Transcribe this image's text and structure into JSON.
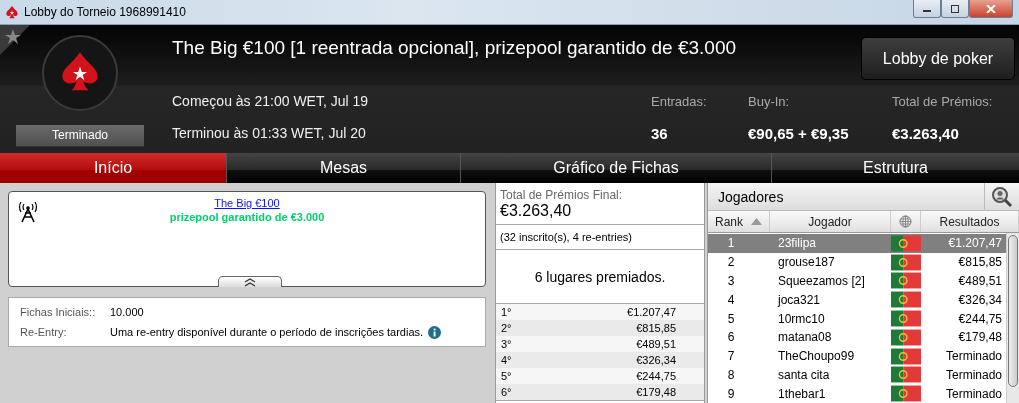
{
  "window": {
    "title": "Lobby do Torneio 1968991410"
  },
  "header": {
    "title": "The Big €100 [1 reentrada opcional], prizepool garantido de €3.000",
    "status": "Terminado",
    "started": "Começou às 21:00 WET, Jul 19",
    "ended": "Terminou às 01:33 WET, Jul 20",
    "button": "Lobby de poker",
    "stats": [
      {
        "label": "Entradas:",
        "value": "36"
      },
      {
        "label": "Buy-In:",
        "value": "€90,65 + €9,35"
      },
      {
        "label": "Total de Prémios:",
        "value": "€3.263,40"
      }
    ]
  },
  "tabs": [
    {
      "label": "Início",
      "selected": true
    },
    {
      "label": "Mesas",
      "selected": false
    },
    {
      "label": "Gráfico de Fichas",
      "selected": false
    },
    {
      "label": "Estrutura",
      "selected": false
    }
  ],
  "news": {
    "link": "The Big €100",
    "subtitle": "prizepool garantido de €3.000"
  },
  "info": [
    {
      "label": "Fichas Iniciais::",
      "value": "10.000",
      "has_info": false
    },
    {
      "label": "Re-Entry:",
      "value": "Uma re-entry disponível durante o período de inscrições tardias.",
      "has_info": true
    }
  ],
  "prizes": {
    "total_label": "Total de Prémios Final:",
    "total": "€3.263,40",
    "entries": "(32 inscrito(s), 4 re-entries)",
    "places": "6 lugares premiados.",
    "rows": [
      {
        "place": "1°",
        "amount": "€1.207,47"
      },
      {
        "place": "2°",
        "amount": "€815,85"
      },
      {
        "place": "3°",
        "amount": "€489,51"
      },
      {
        "place": "4°",
        "amount": "€326,34"
      },
      {
        "place": "5°",
        "amount": "€244,75"
      },
      {
        "place": "6°",
        "amount": "€179,48"
      }
    ]
  },
  "players": {
    "title": "Jogadores",
    "columns": [
      {
        "kind": "text",
        "label": "Rank",
        "sorted": true
      },
      {
        "kind": "text",
        "label": "Jogador",
        "sorted": false
      },
      {
        "kind": "globe"
      },
      {
        "kind": "text",
        "label": "Resultados",
        "sorted": false
      }
    ],
    "rows": [
      {
        "rank": "1",
        "name": "23filipa",
        "result": "€1.207,47",
        "selected": true
      },
      {
        "rank": "2",
        "name": "grouse187",
        "result": "€815,85",
        "selected": false
      },
      {
        "rank": "3",
        "name": "Squeezamos [2]",
        "result": "€489,51",
        "selected": false
      },
      {
        "rank": "4",
        "name": "joca321",
        "result": "€326,34",
        "selected": false
      },
      {
        "rank": "5",
        "name": "10rmc10",
        "result": "€244,75",
        "selected": false
      },
      {
        "rank": "6",
        "name": "matana08",
        "result": "€179,48",
        "selected": false
      },
      {
        "rank": "7",
        "name": "TheChoupo99",
        "result": "Terminado",
        "selected": false
      },
      {
        "rank": "8",
        "name": "santa cita",
        "result": "Terminado",
        "selected": false
      },
      {
        "rank": "9",
        "name": "1thebar1",
        "result": "Terminado",
        "selected": false
      }
    ]
  }
}
